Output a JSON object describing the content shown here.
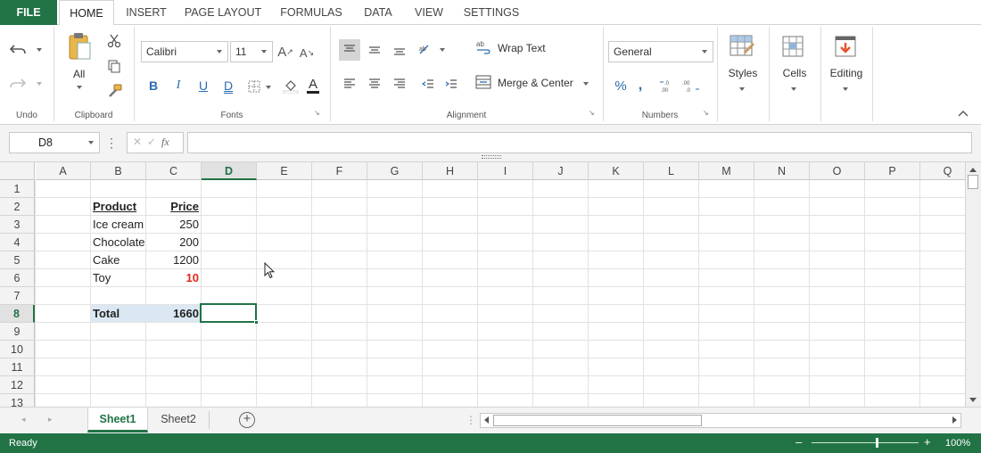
{
  "tabs": {
    "file": "FILE",
    "home": "HOME",
    "insert": "INSERT",
    "page_layout": "PAGE LAYOUT",
    "formulas": "FORMULAS",
    "data": "DATA",
    "view": "VIEW",
    "settings": "SETTINGS"
  },
  "ribbon": {
    "undo_label": "Undo",
    "clipboard_label": "Clipboard",
    "paste_label": "All",
    "fonts_label": "Fonts",
    "font_name": "Calibri",
    "font_size": "11",
    "alignment_label": "Alignment",
    "wrap_text": "Wrap Text",
    "merge_center": "Merge & Center",
    "numbers_label": "Numbers",
    "number_format": "General",
    "styles": "Styles",
    "cells": "Cells",
    "editing": "Editing",
    "bold": "B",
    "italic": "I",
    "underline": "U",
    "double_underline": "D"
  },
  "formula_bar": {
    "name_box": "D8",
    "fx": "fx",
    "formula": ""
  },
  "grid": {
    "columns": [
      "A",
      "B",
      "C",
      "D",
      "E",
      "F",
      "G",
      "H",
      "I",
      "J",
      "K",
      "L",
      "M",
      "N",
      "O",
      "P",
      "Q"
    ],
    "selected_column": "D",
    "rows": [
      "1",
      "2",
      "3",
      "4",
      "5",
      "6",
      "7",
      "8",
      "9",
      "10",
      "11",
      "12",
      "13"
    ],
    "selected_row": "8",
    "selected_cell": "D8",
    "data": {
      "B2": "Product",
      "C2": "Price",
      "B3": "Ice cream",
      "C3": "250",
      "B4": "Chocolate",
      "C4": "200",
      "B5": "Cake",
      "C5": "1200",
      "B6": "Toy",
      "C6": "10",
      "B8": "Total",
      "C8": "1660"
    }
  },
  "sheets": {
    "tabs": [
      "Sheet1",
      "Sheet2"
    ],
    "active": "Sheet1"
  },
  "status": {
    "ready": "Ready",
    "zoom": "100%",
    "zoom_fraction": 0.6
  },
  "colors": {
    "accent": "#217346",
    "negative_red": "#e0281b",
    "selection_fill": "#dbe8f3",
    "link_blue": "#2b6cb0"
  }
}
